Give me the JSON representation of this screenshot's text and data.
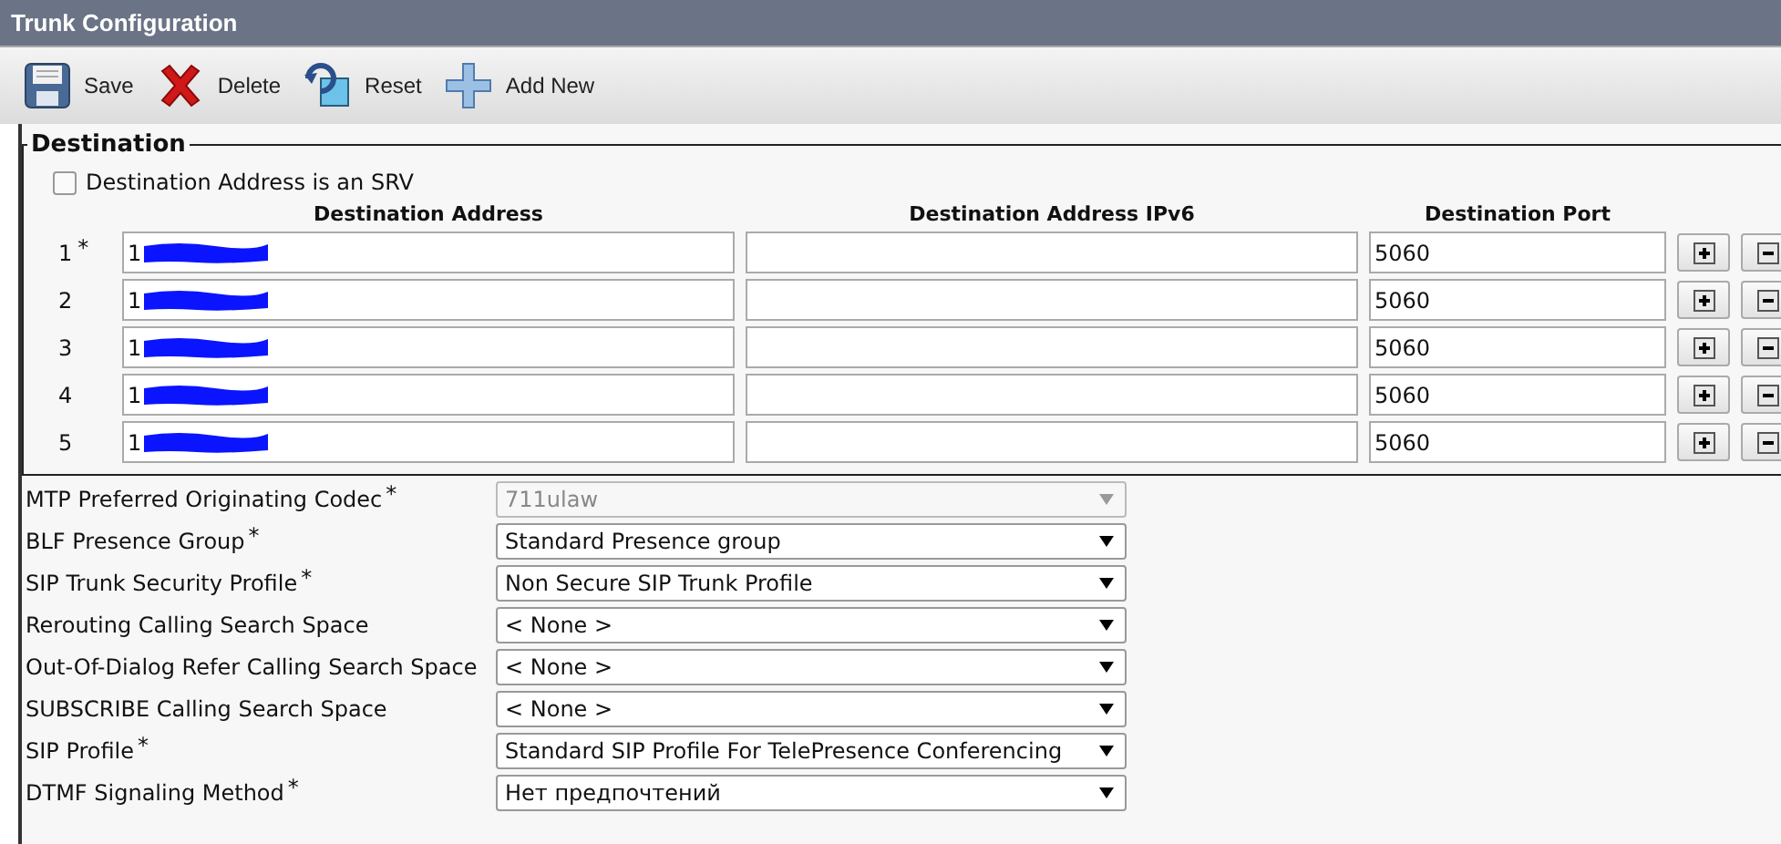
{
  "window": {
    "title": "Trunk Configuration"
  },
  "toolbar": [
    {
      "kind": "save",
      "label": "Save"
    },
    {
      "kind": "delete",
      "label": "Delete"
    },
    {
      "kind": "reset",
      "label": "Reset"
    },
    {
      "kind": "add",
      "label": "Add New"
    }
  ],
  "destination": {
    "legend": "Destination",
    "srv_checkbox": {
      "label": "Destination Address is an SRV",
      "checked": false
    },
    "columns": [
      "Destination Address",
      "Destination Address IPv6",
      "Destination Port"
    ],
    "rows": [
      {
        "index": "1",
        "required_mark": "*",
        "address": "1",
        "redacted": true,
        "ipv6": "",
        "port": "5060"
      },
      {
        "index": "2",
        "address": "1",
        "redacted": true,
        "ipv6": "",
        "port": "5060"
      },
      {
        "index": "3",
        "address": "1",
        "redacted": true,
        "ipv6": "",
        "port": "5060"
      },
      {
        "index": "4",
        "address": "1",
        "redacted": true,
        "ipv6": "",
        "port": "5060"
      },
      {
        "index": "5",
        "address": "1",
        "redacted": true,
        "ipv6": "",
        "port": "5060"
      }
    ]
  },
  "fields": [
    {
      "label": "MTP Preferred Originating Codec",
      "required_mark": "*",
      "value": "711ulaw",
      "disabled": true
    },
    {
      "label": "BLF Presence Group",
      "required_mark": "*",
      "value": "Standard Presence group",
      "disabled": false
    },
    {
      "label": "SIP Trunk Security Profile",
      "required_mark": "*",
      "value": "Non Secure SIP Trunk Profile",
      "disabled": false
    },
    {
      "label": "Rerouting Calling Search Space",
      "value": "< None >",
      "disabled": false
    },
    {
      "label": "Out-Of-Dialog Refer Calling Search Space",
      "value": "< None >",
      "disabled": false
    },
    {
      "label": "SUBSCRIBE Calling Search Space",
      "value": "< None >",
      "disabled": false
    },
    {
      "label": "SIP Profile",
      "required_mark": "*",
      "value": "Standard SIP Profile For TelePresence Conferencing",
      "disabled": false
    },
    {
      "label": "DTMF Signaling Method",
      "required_mark": "*",
      "value": "Нет предпочтений",
      "disabled": false
    }
  ]
}
